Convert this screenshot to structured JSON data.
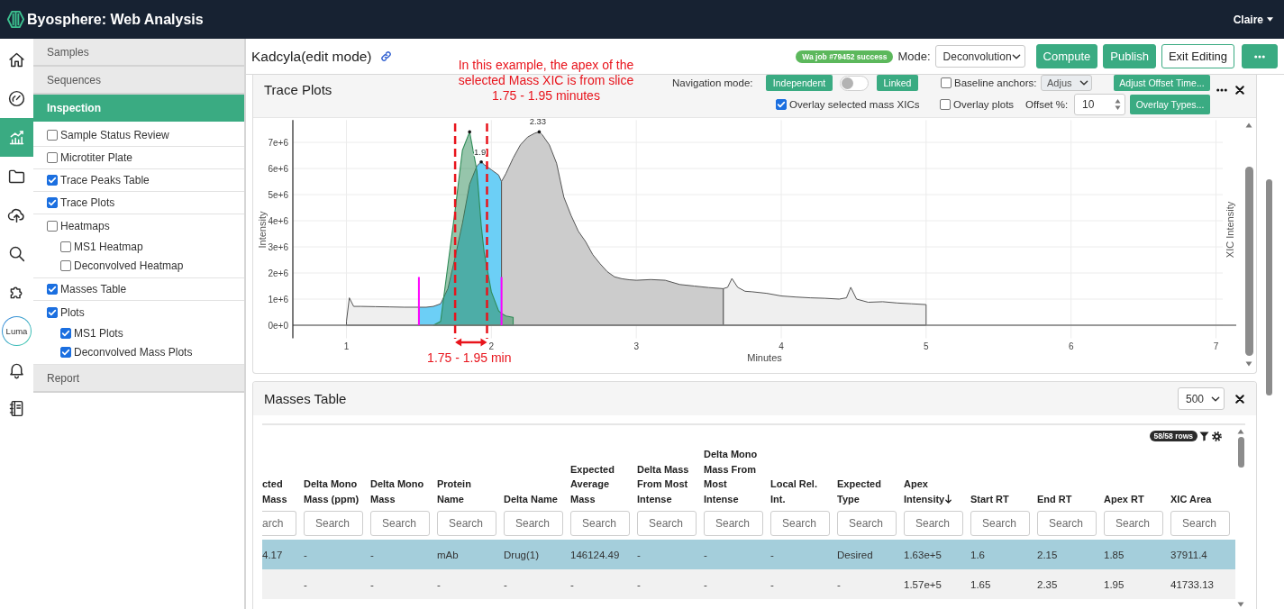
{
  "topbar": {
    "title": "Byosphere: Web Analysis",
    "user": "Claire"
  },
  "rail": [
    {
      "kind": "icon",
      "selected": false
    },
    {
      "kind": "icon",
      "selected": false
    },
    {
      "kind": "icon",
      "selected": true
    },
    {
      "kind": "icon",
      "selected": false
    },
    {
      "kind": "icon",
      "selected": false
    },
    {
      "kind": "icon",
      "selected": false
    },
    {
      "kind": "icon",
      "selected": false
    },
    {
      "kind": "logo",
      "label": "Luma",
      "selected": false
    },
    {
      "kind": "icon",
      "selected": false
    },
    {
      "kind": "icon",
      "selected": false
    }
  ],
  "nav": {
    "sections": [
      {
        "label": "Samples",
        "selected": false
      },
      {
        "label": "Sequences",
        "selected": false
      },
      {
        "label": "Inspection",
        "selected": true,
        "items": [
          {
            "label": "Sample Status Review",
            "checked": false
          },
          {
            "label": "Microtiter Plate",
            "checked": false
          },
          {
            "label": "Trace Peaks Table",
            "checked": true
          },
          {
            "label": "Trace Plots",
            "checked": true
          },
          {
            "label": "Heatmaps",
            "checked": false,
            "children": [
              {
                "label": "MS1 Heatmap",
                "checked": false
              },
              {
                "label": "Deconvolved Heatmap",
                "checked": false
              }
            ]
          },
          {
            "label": "Masses Table",
            "checked": true
          },
          {
            "label": "Plots",
            "checked": true,
            "children": [
              {
                "label": "MS1 Plots",
                "checked": true
              },
              {
                "label": "Deconvolved Mass Plots",
                "checked": true
              }
            ]
          }
        ]
      },
      {
        "label": "Report",
        "selected": false
      }
    ]
  },
  "header": {
    "title": "Kadcyla(edit mode)",
    "job_badge": "Wa job #79452 success",
    "mode_label": "Mode:",
    "mode": "Deconvolution",
    "buttons": [
      {
        "kind": "primary",
        "label": "Compute"
      },
      {
        "kind": "primary",
        "label": "Publish"
      },
      {
        "kind": "outline",
        "label": "Exit Editing"
      },
      {
        "kind": "more"
      }
    ]
  },
  "callout": {
    "text": "In this example, the apex of the selected Mass XIC is from slice 1.75 - 1.95 minutes"
  },
  "trace_plots": {
    "title": "Trace Plots",
    "navigation": {
      "label": "Navigation mode:",
      "left": "Independent",
      "right": "Linked",
      "linked": false
    },
    "baseline_anchors": {
      "label": "Baseline anchors:",
      "checked": false
    },
    "anchor_select": {
      "value": "Adjus",
      "disabled": true
    },
    "adjust_offset_button": "Adjust Offset Time...",
    "overlay_selected": {
      "label": "Overlay selected mass XICs",
      "checked": true
    },
    "overlay_plots": {
      "label": "Overlay plots",
      "checked": false
    },
    "offset": {
      "label": "Offset %:",
      "value": "10"
    },
    "overlay_types_button": "Overlay Types...",
    "right_axis_label": "XIC Intensity",
    "slice_label": "1.75 - 1.95 min",
    "chart_data": {
      "type": "area",
      "xlabel": "Minutes",
      "ylabel": "Intensity",
      "x": [
        1,
        1.02,
        1.05,
        1.1,
        1.2,
        1.3,
        1.4,
        1.5,
        1.55,
        1.6,
        1.65,
        1.7,
        1.75,
        1.8,
        1.85,
        1.9,
        1.93,
        1.95,
        2,
        2.05,
        2.07,
        2.1,
        2.15,
        2.2,
        2.25,
        2.3,
        2.33,
        2.35,
        2.4,
        2.45,
        2.5,
        2.55,
        2.6,
        2.65,
        2.7,
        2.75,
        2.8,
        2.85,
        2.9,
        2.95,
        3,
        3.1,
        3.2,
        3.3,
        3.4,
        3.5,
        3.6,
        3.63,
        3.66,
        3.7,
        3.75,
        3.8,
        3.9,
        4,
        4.1,
        4.2,
        4.3,
        4.4,
        4.45,
        4.48,
        4.52,
        4.6,
        4.7,
        4.8,
        4.9,
        5
      ],
      "series": [
        {
          "color": "#efefef",
          "values": [
            150000,
            1050000,
            720000,
            720000,
            710000,
            700000,
            690000,
            690000,
            null,
            null,
            null,
            null,
            null,
            null,
            null,
            null,
            null,
            null,
            null,
            null,
            null,
            null,
            null,
            null,
            null,
            null,
            null,
            null,
            null,
            null,
            null,
            null,
            null,
            null,
            null,
            null,
            null,
            null,
            null,
            null,
            null,
            null,
            null,
            null,
            null,
            null,
            1400000,
            1450000,
            1790000,
            1450000,
            1300000,
            1280000,
            1220000,
            1120000,
            1080000,
            1050000,
            1030000,
            1000000,
            1050000,
            1450000,
            1000000,
            880000,
            900000,
            850000,
            820000,
            790000
          ]
        },
        {
          "color": "#6ccff6",
          "values": [
            null,
            null,
            null,
            null,
            null,
            null,
            null,
            690000,
            690000,
            720000,
            820000,
            1400000,
            2600000,
            3900000,
            5400000,
            6100000,
            6250000,
            6150000,
            5950000,
            5750000,
            5500000,
            null,
            null,
            null,
            null,
            null,
            null,
            null,
            null,
            null,
            null,
            null,
            null,
            null,
            null,
            null,
            null,
            null,
            null,
            null,
            null,
            null,
            null,
            null,
            null,
            null,
            null,
            null,
            null,
            null,
            null,
            null,
            null,
            null,
            null,
            null,
            null,
            null,
            null,
            null,
            null,
            null,
            null,
            null,
            null,
            null
          ]
        },
        {
          "color": "#cccccc",
          "values": [
            null,
            null,
            null,
            null,
            null,
            null,
            null,
            null,
            null,
            null,
            null,
            null,
            null,
            null,
            null,
            null,
            null,
            null,
            null,
            null,
            5500000,
            5800000,
            6400000,
            6900000,
            7200000,
            7350000,
            7400000,
            7300000,
            6900000,
            6200000,
            4900000,
            4200000,
            3600000,
            3200000,
            2700000,
            2350000,
            2050000,
            1850000,
            1780000,
            1740000,
            1720000,
            1750000,
            1720000,
            1560000,
            1500000,
            1440000,
            1400000,
            null,
            null,
            null,
            null,
            null,
            null,
            null,
            null,
            null,
            null,
            null,
            null,
            null,
            null,
            null,
            null,
            null,
            null,
            null
          ]
        },
        {
          "color": "#2e8b57",
          "values": [
            null,
            null,
            null,
            null,
            null,
            null,
            null,
            null,
            null,
            0,
            150000,
            2300000,
            4400000,
            6700000,
            7400000,
            5900000,
            3800000,
            2800000,
            1280000,
            550000,
            450000,
            350000,
            300000,
            null,
            null,
            null,
            null,
            null,
            null,
            null,
            null,
            null,
            null,
            null,
            null,
            null,
            null,
            null,
            null,
            null,
            null,
            null,
            null,
            null,
            null,
            null,
            null,
            null,
            null,
            null,
            null,
            null,
            null,
            null,
            null,
            null,
            null,
            null,
            null,
            null,
            null,
            null,
            null,
            null,
            null,
            null
          ]
        }
      ],
      "xlim": [
        0.63,
        7.14
      ],
      "ylim": [
        -500000,
        7850000
      ],
      "xticks": [
        1,
        2,
        3,
        4,
        5,
        6,
        7
      ],
      "yticks": [
        {
          "value": 0,
          "label": "0e+0"
        },
        {
          "value": 1000000,
          "label": "1e+6"
        },
        {
          "value": 2000000,
          "label": "2e+6"
        },
        {
          "value": 3000000,
          "label": "3e+6"
        },
        {
          "value": 4000000,
          "label": "4e+6"
        },
        {
          "value": 5000000,
          "label": "5e+6"
        },
        {
          "value": 6000000,
          "label": "6e+6"
        },
        {
          "value": 7000000,
          "label": "7e+6"
        }
      ],
      "grid": true,
      "ref_lines": [
        {
          "axis": "x",
          "value": 1.5,
          "color": "#ff00ff"
        },
        {
          "axis": "x",
          "value": 2.07,
          "color": "#ff00ff"
        },
        {
          "axis": "x",
          "value": 1.75,
          "color": "#e8141c"
        },
        {
          "axis": "x",
          "value": 1.97,
          "color": "#e8141c"
        }
      ],
      "annotations": [
        {
          "x": 1.93,
          "y": 6250000,
          "text": "1.9"
        },
        {
          "x": 2.33,
          "y": 7400000,
          "text": "2.33"
        }
      ]
    }
  },
  "masses_table": {
    "title": "Masses Table",
    "page_size": "500",
    "row_count": "58/58 rows",
    "columns": [
      {
        "label": "cted Mass",
        "placeholder": "arch",
        "sorted": false
      },
      {
        "label": "Delta Mono Mass (ppm)",
        "placeholder": "Search",
        "sorted": false
      },
      {
        "label": "Delta Mono Mass",
        "placeholder": "Search",
        "sorted": false
      },
      {
        "label": "Protein Name",
        "placeholder": "Search",
        "sorted": false
      },
      {
        "label": "Delta Name",
        "placeholder": "Search",
        "sorted": false
      },
      {
        "label": "Expected Average Mass",
        "placeholder": "Search",
        "sorted": false
      },
      {
        "label": "Delta Mass From Most Intense",
        "placeholder": "Search",
        "sorted": false
      },
      {
        "label": "Delta Mono Mass From Most Intense",
        "placeholder": "Search",
        "sorted": false
      },
      {
        "label": "Local Rel. Int.",
        "placeholder": "Search",
        "sorted": false
      },
      {
        "label": "Expected Type",
        "placeholder": "Search",
        "sorted": false
      },
      {
        "label": "Apex Intensity",
        "placeholder": "Search",
        "sorted": true
      },
      {
        "label": "Start RT",
        "placeholder": "Search",
        "sorted": false
      },
      {
        "label": "End RT",
        "placeholder": "Search",
        "sorted": false
      },
      {
        "label": "Apex RT",
        "placeholder": "Search",
        "sorted": false
      },
      {
        "label": "XIC Area",
        "placeholder": "Search",
        "sorted": false
      }
    ],
    "rows": [
      {
        "selected": true,
        "cells": [
          "4.17",
          "-",
          "-",
          "mAb",
          "Drug(1)",
          "146124.49",
          "-",
          "-",
          "-",
          "Desired",
          "1.63e+5",
          "1.6",
          "2.15",
          "1.85",
          "37911.4"
        ]
      },
      {
        "selected": false,
        "cells": [
          null,
          "-",
          "-",
          "-",
          "-",
          "-",
          "-",
          "-",
          "-",
          "-",
          "1.57e+5",
          "1.65",
          "2.35",
          "1.95",
          "41733.13"
        ]
      }
    ]
  }
}
